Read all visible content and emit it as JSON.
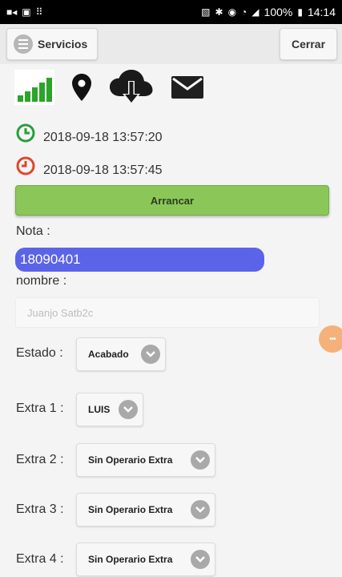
{
  "statusbar": {
    "battery": "100%",
    "time": "14:14"
  },
  "toolbar": {
    "services_label": "Servicios",
    "close_label": "Cerrar"
  },
  "times": {
    "start": "2018-09-18 13:57:20",
    "end": "2018-09-18 13:57:45"
  },
  "actions": {
    "start_label": "Arrancar"
  },
  "form": {
    "nota_label": "Nota :",
    "nota_value": "18090401",
    "nombre_label": "nombre :",
    "nombre_placeholder": "Juanjo Satb2c",
    "estado_label": "Estado :",
    "estado_value": "Acabado",
    "extra1_label": "Extra 1 :",
    "extra1_value": "LUIS",
    "extra2_label": "Extra 2 :",
    "extra2_value": "Sin Operario Extra",
    "extra3_label": "Extra 3 :",
    "extra3_value": "Sin Operario Extra",
    "extra4_label": "Extra 4 :",
    "extra4_value": "Sin Operario Extra"
  },
  "colors": {
    "start_green": "#8bc659",
    "clock_green": "#2a9d3c",
    "clock_red": "#e0462b",
    "nota_bg": "#5b64e8",
    "fab_orange": "#f6b17a"
  }
}
